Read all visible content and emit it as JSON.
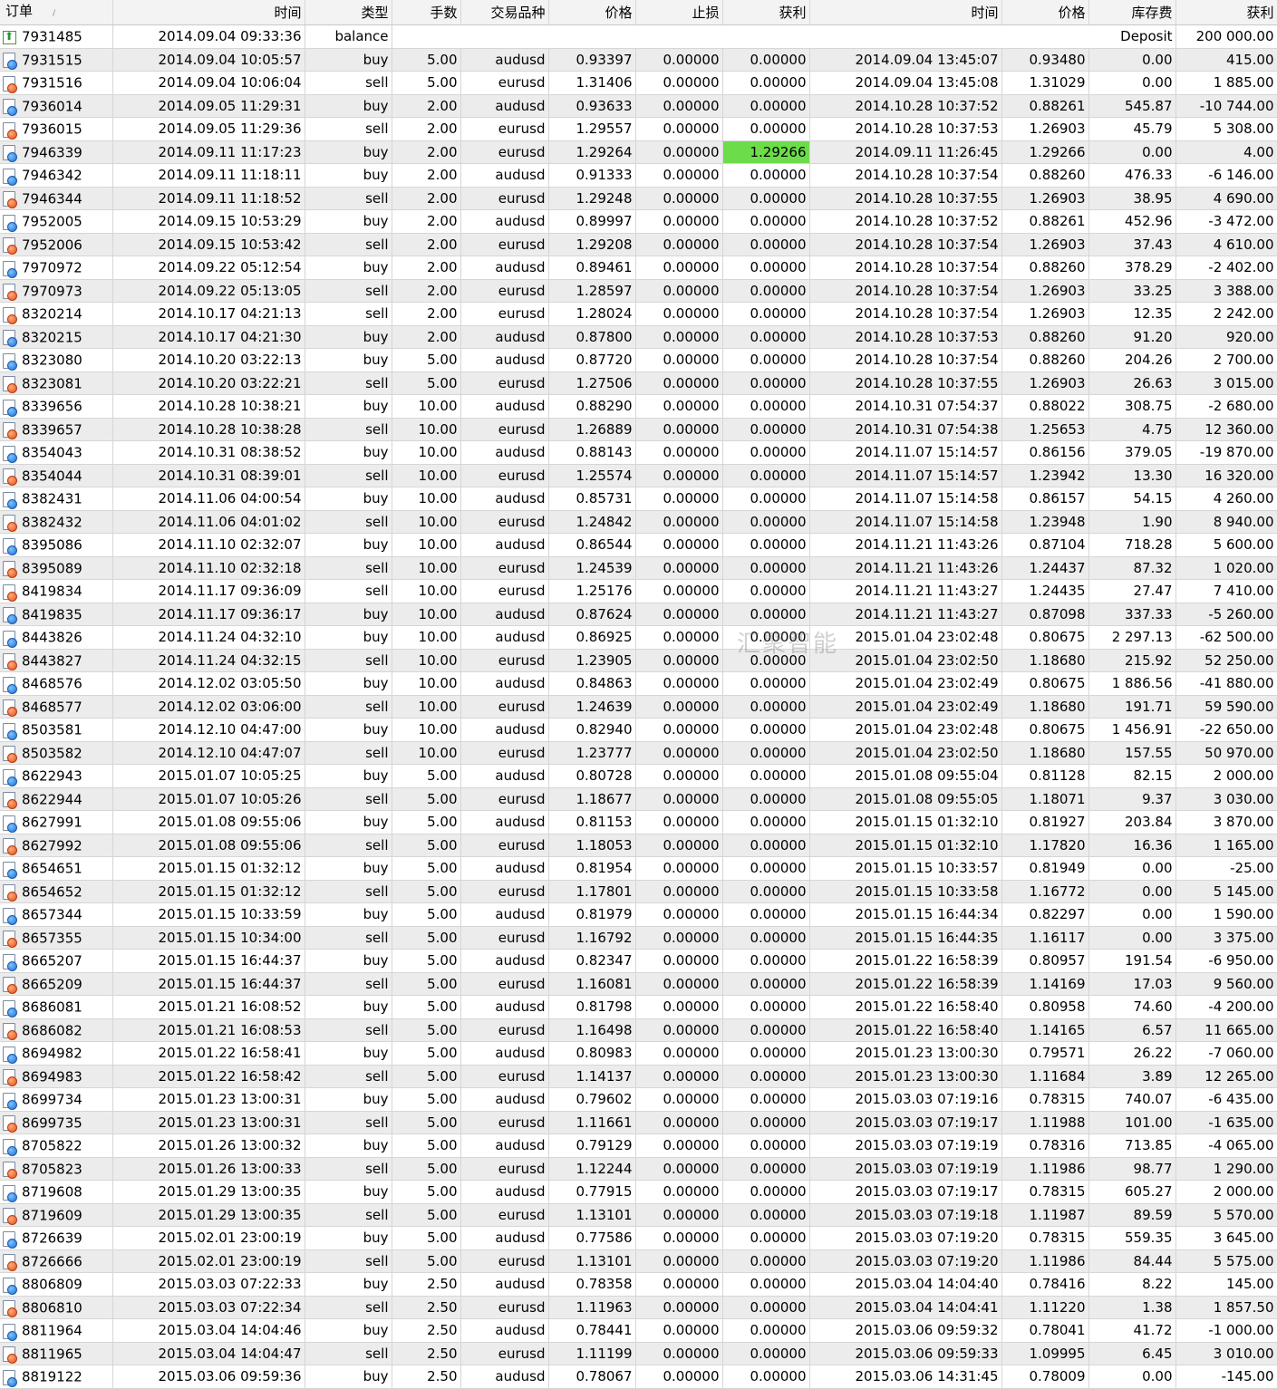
{
  "headers": {
    "order": "订单",
    "open_time": "时间",
    "type": "类型",
    "lots": "手数",
    "symbol": "交易品种",
    "open_price": "价格",
    "stop_loss": "止损",
    "take_profit": "获利",
    "close_time": "时间",
    "close_price": "价格",
    "swap": "库存费",
    "profit": "获利"
  },
  "sort_indicator": "/",
  "balance_row": {
    "order": "7931485",
    "time": "2014.09.04 09:33:36",
    "type": "balance",
    "comment": "Deposit",
    "amount": "200 000.00"
  },
  "trades": [
    [
      "7931515",
      "2014.09.04 10:05:57",
      "buy",
      "5.00",
      "audusd",
      "0.93397",
      "0.00000",
      "0.00000",
      "2014.09.04 13:45:07",
      "0.93480",
      "0.00",
      "415.00"
    ],
    [
      "7931516",
      "2014.09.04 10:06:04",
      "sell",
      "5.00",
      "eurusd",
      "1.31406",
      "0.00000",
      "0.00000",
      "2014.09.04 13:45:08",
      "1.31029",
      "0.00",
      "1 885.00"
    ],
    [
      "7936014",
      "2014.09.05 11:29:31",
      "buy",
      "2.00",
      "audusd",
      "0.93633",
      "0.00000",
      "0.00000",
      "2014.10.28 10:37:52",
      "0.88261",
      "545.87",
      "-10 744.00"
    ],
    [
      "7936015",
      "2014.09.05 11:29:36",
      "sell",
      "2.00",
      "eurusd",
      "1.29557",
      "0.00000",
      "0.00000",
      "2014.10.28 10:37:53",
      "1.26903",
      "45.79",
      "5 308.00"
    ],
    [
      "7946339",
      "2014.09.11 11:17:23",
      "buy",
      "2.00",
      "eurusd",
      "1.29264",
      "0.00000",
      "1.29266",
      "2014.09.11 11:26:45",
      "1.29266",
      "0.00",
      "4.00"
    ],
    [
      "7946342",
      "2014.09.11 11:18:11",
      "buy",
      "2.00",
      "audusd",
      "0.91333",
      "0.00000",
      "0.00000",
      "2014.10.28 10:37:54",
      "0.88260",
      "476.33",
      "-6 146.00"
    ],
    [
      "7946344",
      "2014.09.11 11:18:52",
      "sell",
      "2.00",
      "eurusd",
      "1.29248",
      "0.00000",
      "0.00000",
      "2014.10.28 10:37:55",
      "1.26903",
      "38.95",
      "4 690.00"
    ],
    [
      "7952005",
      "2014.09.15 10:53:29",
      "buy",
      "2.00",
      "audusd",
      "0.89997",
      "0.00000",
      "0.00000",
      "2014.10.28 10:37:52",
      "0.88261",
      "452.96",
      "-3 472.00"
    ],
    [
      "7952006",
      "2014.09.15 10:53:42",
      "sell",
      "2.00",
      "eurusd",
      "1.29208",
      "0.00000",
      "0.00000",
      "2014.10.28 10:37:54",
      "1.26903",
      "37.43",
      "4 610.00"
    ],
    [
      "7970972",
      "2014.09.22 05:12:54",
      "buy",
      "2.00",
      "audusd",
      "0.89461",
      "0.00000",
      "0.00000",
      "2014.10.28 10:37:54",
      "0.88260",
      "378.29",
      "-2 402.00"
    ],
    [
      "7970973",
      "2014.09.22 05:13:05",
      "sell",
      "2.00",
      "eurusd",
      "1.28597",
      "0.00000",
      "0.00000",
      "2014.10.28 10:37:54",
      "1.26903",
      "33.25",
      "3 388.00"
    ],
    [
      "8320214",
      "2014.10.17 04:21:13",
      "sell",
      "2.00",
      "eurusd",
      "1.28024",
      "0.00000",
      "0.00000",
      "2014.10.28 10:37:54",
      "1.26903",
      "12.35",
      "2 242.00"
    ],
    [
      "8320215",
      "2014.10.17 04:21:30",
      "buy",
      "2.00",
      "audusd",
      "0.87800",
      "0.00000",
      "0.00000",
      "2014.10.28 10:37:53",
      "0.88260",
      "91.20",
      "920.00"
    ],
    [
      "8323080",
      "2014.10.20 03:22:13",
      "buy",
      "5.00",
      "audusd",
      "0.87720",
      "0.00000",
      "0.00000",
      "2014.10.28 10:37:54",
      "0.88260",
      "204.26",
      "2 700.00"
    ],
    [
      "8323081",
      "2014.10.20 03:22:21",
      "sell",
      "5.00",
      "eurusd",
      "1.27506",
      "0.00000",
      "0.00000",
      "2014.10.28 10:37:55",
      "1.26903",
      "26.63",
      "3 015.00"
    ],
    [
      "8339656",
      "2014.10.28 10:38:21",
      "buy",
      "10.00",
      "audusd",
      "0.88290",
      "0.00000",
      "0.00000",
      "2014.10.31 07:54:37",
      "0.88022",
      "308.75",
      "-2 680.00"
    ],
    [
      "8339657",
      "2014.10.28 10:38:28",
      "sell",
      "10.00",
      "eurusd",
      "1.26889",
      "0.00000",
      "0.00000",
      "2014.10.31 07:54:38",
      "1.25653",
      "4.75",
      "12 360.00"
    ],
    [
      "8354043",
      "2014.10.31 08:38:52",
      "buy",
      "10.00",
      "audusd",
      "0.88143",
      "0.00000",
      "0.00000",
      "2014.11.07 15:14:57",
      "0.86156",
      "379.05",
      "-19 870.00"
    ],
    [
      "8354044",
      "2014.10.31 08:39:01",
      "sell",
      "10.00",
      "eurusd",
      "1.25574",
      "0.00000",
      "0.00000",
      "2014.11.07 15:14:57",
      "1.23942",
      "13.30",
      "16 320.00"
    ],
    [
      "8382431",
      "2014.11.06 04:00:54",
      "buy",
      "10.00",
      "audusd",
      "0.85731",
      "0.00000",
      "0.00000",
      "2014.11.07 15:14:58",
      "0.86157",
      "54.15",
      "4 260.00"
    ],
    [
      "8382432",
      "2014.11.06 04:01:02",
      "sell",
      "10.00",
      "eurusd",
      "1.24842",
      "0.00000",
      "0.00000",
      "2014.11.07 15:14:58",
      "1.23948",
      "1.90",
      "8 940.00"
    ],
    [
      "8395086",
      "2014.11.10 02:32:07",
      "buy",
      "10.00",
      "audusd",
      "0.86544",
      "0.00000",
      "0.00000",
      "2014.11.21 11:43:26",
      "0.87104",
      "718.28",
      "5 600.00"
    ],
    [
      "8395089",
      "2014.11.10 02:32:18",
      "sell",
      "10.00",
      "eurusd",
      "1.24539",
      "0.00000",
      "0.00000",
      "2014.11.21 11:43:26",
      "1.24437",
      "87.32",
      "1 020.00"
    ],
    [
      "8419834",
      "2014.11.17 09:36:09",
      "sell",
      "10.00",
      "eurusd",
      "1.25176",
      "0.00000",
      "0.00000",
      "2014.11.21 11:43:27",
      "1.24435",
      "27.47",
      "7 410.00"
    ],
    [
      "8419835",
      "2014.11.17 09:36:17",
      "buy",
      "10.00",
      "audusd",
      "0.87624",
      "0.00000",
      "0.00000",
      "2014.11.21 11:43:27",
      "0.87098",
      "337.33",
      "-5 260.00"
    ],
    [
      "8443826",
      "2014.11.24 04:32:10",
      "buy",
      "10.00",
      "audusd",
      "0.86925",
      "0.00000",
      "0.00000",
      "2015.01.04 23:02:48",
      "0.80675",
      "2 297.13",
      "-62 500.00"
    ],
    [
      "8443827",
      "2014.11.24 04:32:15",
      "sell",
      "10.00",
      "eurusd",
      "1.23905",
      "0.00000",
      "0.00000",
      "2015.01.04 23:02:50",
      "1.18680",
      "215.92",
      "52 250.00"
    ],
    [
      "8468576",
      "2014.12.02 03:05:50",
      "buy",
      "10.00",
      "audusd",
      "0.84863",
      "0.00000",
      "0.00000",
      "2015.01.04 23:02:49",
      "0.80675",
      "1 886.56",
      "-41 880.00"
    ],
    [
      "8468577",
      "2014.12.02 03:06:00",
      "sell",
      "10.00",
      "eurusd",
      "1.24639",
      "0.00000",
      "0.00000",
      "2015.01.04 23:02:49",
      "1.18680",
      "191.71",
      "59 590.00"
    ],
    [
      "8503581",
      "2014.12.10 04:47:00",
      "buy",
      "10.00",
      "audusd",
      "0.82940",
      "0.00000",
      "0.00000",
      "2015.01.04 23:02:48",
      "0.80675",
      "1 456.91",
      "-22 650.00"
    ],
    [
      "8503582",
      "2014.12.10 04:47:07",
      "sell",
      "10.00",
      "eurusd",
      "1.23777",
      "0.00000",
      "0.00000",
      "2015.01.04 23:02:50",
      "1.18680",
      "157.55",
      "50 970.00"
    ],
    [
      "8622943",
      "2015.01.07 10:05:25",
      "buy",
      "5.00",
      "audusd",
      "0.80728",
      "0.00000",
      "0.00000",
      "2015.01.08 09:55:04",
      "0.81128",
      "82.15",
      "2 000.00"
    ],
    [
      "8622944",
      "2015.01.07 10:05:26",
      "sell",
      "5.00",
      "eurusd",
      "1.18677",
      "0.00000",
      "0.00000",
      "2015.01.08 09:55:05",
      "1.18071",
      "9.37",
      "3 030.00"
    ],
    [
      "8627991",
      "2015.01.08 09:55:06",
      "buy",
      "5.00",
      "audusd",
      "0.81153",
      "0.00000",
      "0.00000",
      "2015.01.15 01:32:10",
      "0.81927",
      "203.84",
      "3 870.00"
    ],
    [
      "8627992",
      "2015.01.08 09:55:06",
      "sell",
      "5.00",
      "eurusd",
      "1.18053",
      "0.00000",
      "0.00000",
      "2015.01.15 01:32:10",
      "1.17820",
      "16.36",
      "1 165.00"
    ],
    [
      "8654651",
      "2015.01.15 01:32:12",
      "buy",
      "5.00",
      "audusd",
      "0.81954",
      "0.00000",
      "0.00000",
      "2015.01.15 10:33:57",
      "0.81949",
      "0.00",
      "-25.00"
    ],
    [
      "8654652",
      "2015.01.15 01:32:12",
      "sell",
      "5.00",
      "eurusd",
      "1.17801",
      "0.00000",
      "0.00000",
      "2015.01.15 10:33:58",
      "1.16772",
      "0.00",
      "5 145.00"
    ],
    [
      "8657344",
      "2015.01.15 10:33:59",
      "buy",
      "5.00",
      "audusd",
      "0.81979",
      "0.00000",
      "0.00000",
      "2015.01.15 16:44:34",
      "0.82297",
      "0.00",
      "1 590.00"
    ],
    [
      "8657355",
      "2015.01.15 10:34:00",
      "sell",
      "5.00",
      "eurusd",
      "1.16792",
      "0.00000",
      "0.00000",
      "2015.01.15 16:44:35",
      "1.16117",
      "0.00",
      "3 375.00"
    ],
    [
      "8665207",
      "2015.01.15 16:44:37",
      "buy",
      "5.00",
      "audusd",
      "0.82347",
      "0.00000",
      "0.00000",
      "2015.01.22 16:58:39",
      "0.80957",
      "191.54",
      "-6 950.00"
    ],
    [
      "8665209",
      "2015.01.15 16:44:37",
      "sell",
      "5.00",
      "eurusd",
      "1.16081",
      "0.00000",
      "0.00000",
      "2015.01.22 16:58:39",
      "1.14169",
      "17.03",
      "9 560.00"
    ],
    [
      "8686081",
      "2015.01.21 16:08:52",
      "buy",
      "5.00",
      "audusd",
      "0.81798",
      "0.00000",
      "0.00000",
      "2015.01.22 16:58:40",
      "0.80958",
      "74.60",
      "-4 200.00"
    ],
    [
      "8686082",
      "2015.01.21 16:08:53",
      "sell",
      "5.00",
      "eurusd",
      "1.16498",
      "0.00000",
      "0.00000",
      "2015.01.22 16:58:40",
      "1.14165",
      "6.57",
      "11 665.00"
    ],
    [
      "8694982",
      "2015.01.22 16:58:41",
      "buy",
      "5.00",
      "audusd",
      "0.80983",
      "0.00000",
      "0.00000",
      "2015.01.23 13:00:30",
      "0.79571",
      "26.22",
      "-7 060.00"
    ],
    [
      "8694983",
      "2015.01.22 16:58:42",
      "sell",
      "5.00",
      "eurusd",
      "1.14137",
      "0.00000",
      "0.00000",
      "2015.01.23 13:00:30",
      "1.11684",
      "3.89",
      "12 265.00"
    ],
    [
      "8699734",
      "2015.01.23 13:00:31",
      "buy",
      "5.00",
      "audusd",
      "0.79602",
      "0.00000",
      "0.00000",
      "2015.03.03 07:19:16",
      "0.78315",
      "740.07",
      "-6 435.00"
    ],
    [
      "8699735",
      "2015.01.23 13:00:31",
      "sell",
      "5.00",
      "eurusd",
      "1.11661",
      "0.00000",
      "0.00000",
      "2015.03.03 07:19:17",
      "1.11988",
      "101.00",
      "-1 635.00"
    ],
    [
      "8705822",
      "2015.01.26 13:00:32",
      "buy",
      "5.00",
      "audusd",
      "0.79129",
      "0.00000",
      "0.00000",
      "2015.03.03 07:19:19",
      "0.78316",
      "713.85",
      "-4 065.00"
    ],
    [
      "8705823",
      "2015.01.26 13:00:33",
      "sell",
      "5.00",
      "eurusd",
      "1.12244",
      "0.00000",
      "0.00000",
      "2015.03.03 07:19:19",
      "1.11986",
      "98.77",
      "1 290.00"
    ],
    [
      "8719608",
      "2015.01.29 13:00:35",
      "buy",
      "5.00",
      "audusd",
      "0.77915",
      "0.00000",
      "0.00000",
      "2015.03.03 07:19:17",
      "0.78315",
      "605.27",
      "2 000.00"
    ],
    [
      "8719609",
      "2015.01.29 13:00:35",
      "sell",
      "5.00",
      "eurusd",
      "1.13101",
      "0.00000",
      "0.00000",
      "2015.03.03 07:19:18",
      "1.11987",
      "89.59",
      "5 570.00"
    ],
    [
      "8726639",
      "2015.02.01 23:00:19",
      "buy",
      "5.00",
      "audusd",
      "0.77586",
      "0.00000",
      "0.00000",
      "2015.03.03 07:19:20",
      "0.78315",
      "559.35",
      "3 645.00"
    ],
    [
      "8726666",
      "2015.02.01 23:00:19",
      "sell",
      "5.00",
      "eurusd",
      "1.13101",
      "0.00000",
      "0.00000",
      "2015.03.03 07:19:20",
      "1.11986",
      "84.44",
      "5 575.00"
    ],
    [
      "8806809",
      "2015.03.03 07:22:33",
      "buy",
      "2.50",
      "audusd",
      "0.78358",
      "0.00000",
      "0.00000",
      "2015.03.04 14:04:40",
      "0.78416",
      "8.22",
      "145.00"
    ],
    [
      "8806810",
      "2015.03.03 07:22:34",
      "sell",
      "2.50",
      "eurusd",
      "1.11963",
      "0.00000",
      "0.00000",
      "2015.03.04 14:04:41",
      "1.11220",
      "1.38",
      "1 857.50"
    ],
    [
      "8811964",
      "2015.03.04 14:04:46",
      "buy",
      "2.50",
      "audusd",
      "0.78441",
      "0.00000",
      "0.00000",
      "2015.03.06 09:59:32",
      "0.78041",
      "41.72",
      "-1 000.00"
    ],
    [
      "8811965",
      "2015.03.04 14:04:47",
      "sell",
      "2.50",
      "eurusd",
      "1.11199",
      "0.00000",
      "0.00000",
      "2015.03.06 09:59:33",
      "1.09995",
      "6.45",
      "3 010.00"
    ],
    [
      "8819122",
      "2015.03.06 09:59:36",
      "buy",
      "2.50",
      "audusd",
      "0.78067",
      "0.00000",
      "0.00000",
      "2015.03.06 14:31:45",
      "0.78009",
      "0.00",
      "-145.00"
    ]
  ],
  "highlight": {
    "order": "7946339",
    "field": "take_profit",
    "color": "#6cdc4a"
  },
  "watermark": "汇聚智能",
  "icons": {
    "trade": "order-ticket-icon",
    "deposit": "deposit-icon"
  }
}
